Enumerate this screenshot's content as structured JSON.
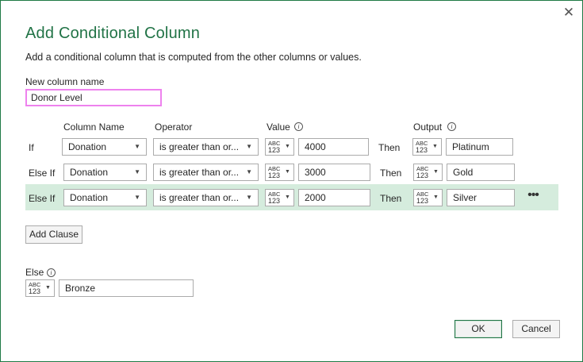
{
  "dialog": {
    "title": "Add Conditional Column",
    "subtitle": "Add a conditional column that is computed from the other columns or values.",
    "close_icon": "close-icon"
  },
  "new_column": {
    "label": "New column name",
    "value": "Donor Level"
  },
  "headers": {
    "column_name": "Column Name",
    "operator": "Operator",
    "value": "Value",
    "output": "Output"
  },
  "type_selector": {
    "abc": "ABC",
    "num": "123"
  },
  "clauses": [
    {
      "prefix": "If",
      "column": "Donation",
      "operator": "is greater than or...",
      "value": "4000",
      "then": "Then",
      "output": "Platinum"
    },
    {
      "prefix": "Else If",
      "column": "Donation",
      "operator": "is greater than or...",
      "value": "3000",
      "then": "Then",
      "output": "Gold"
    },
    {
      "prefix": "Else If",
      "column": "Donation",
      "operator": "is greater than or...",
      "value": "2000",
      "then": "Then",
      "output": "Silver"
    }
  ],
  "more_options": "•••",
  "add_clause": "Add Clause",
  "else": {
    "label": "Else",
    "value": "Bronze"
  },
  "buttons": {
    "ok": "OK",
    "cancel": "Cancel"
  },
  "colors": {
    "accent": "#217346",
    "highlight_row": "#d5ecdd",
    "name_field_border": "#ee82ee"
  }
}
